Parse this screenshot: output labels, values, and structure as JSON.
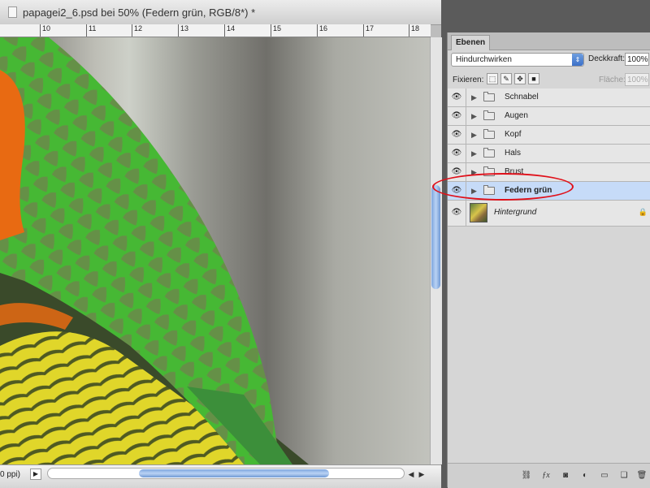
{
  "document": {
    "title": "papagei2_6.psd bei 50% (Federn grün, RGB/8*) *",
    "ruler_ticks": [
      "10",
      "11",
      "12",
      "13",
      "14",
      "15",
      "16",
      "17",
      "18"
    ],
    "zoom_status": "0 ppi)"
  },
  "panel": {
    "tab_label": "Ebenen",
    "blend_mode": "Hindurchwirken",
    "opacity_label": "Deckkraft:",
    "opacity_value": "100%",
    "lock_label": "Fixieren:",
    "fill_label": "Fläche:",
    "fill_value": "100%",
    "layers": [
      {
        "name": "Schnabel"
      },
      {
        "name": "Augen"
      },
      {
        "name": "Kopf"
      },
      {
        "name": "Hals"
      },
      {
        "name": "Brust"
      },
      {
        "name": "Federn grün"
      }
    ],
    "background_layer": "Hintergrund",
    "bottom_icons": [
      "link-icon",
      "fx-icon",
      "mask-icon",
      "adjustment-icon",
      "group-icon",
      "new-layer-icon",
      "trash-icon"
    ]
  },
  "colors": {
    "selection": "#c6dbf8",
    "annotation": "#e0101a",
    "feather_green": "#4fbf3a",
    "feather_orange": "#e86a12",
    "feather_yellow": "#e3da25"
  }
}
